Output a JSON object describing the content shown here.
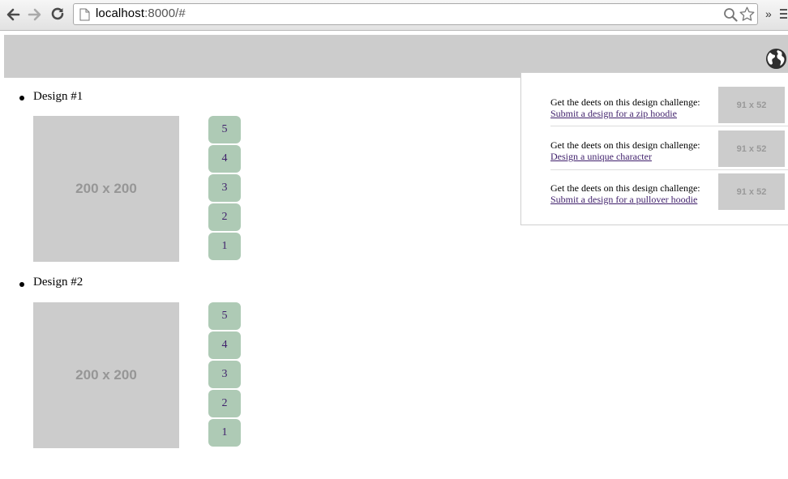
{
  "browser": {
    "url_host": "localhost",
    "url_rest": ":8000/#",
    "extensions_label": "»"
  },
  "designs": [
    {
      "label": "Design #1",
      "image_label": "200 x 200",
      "votes": [
        "5",
        "4",
        "3",
        "2",
        "1"
      ]
    },
    {
      "label": "Design #2",
      "image_label": "200 x 200",
      "votes": [
        "5",
        "4",
        "3",
        "2",
        "1"
      ]
    }
  ],
  "challenges": [
    {
      "text": "Get the deets on this design challenge:",
      "link": "Submit a design for a zip hoodie",
      "thumb": "91 x 52"
    },
    {
      "text": "Get the deets on this design challenge:",
      "link": "Design a unique character",
      "thumb": "91 x 52"
    },
    {
      "text": "Get the deets on this design challenge:",
      "link": "Submit a design for a pullover hoodie",
      "thumb": "91 x 52"
    }
  ],
  "colors": {
    "header_bg": "#cccccc",
    "vote_bg": "#aecab5",
    "link": "#3f1f6b"
  },
  "icons": [
    "back-arrow-icon",
    "forward-arrow-icon",
    "reload-icon",
    "page-icon",
    "zoom-icon",
    "star-icon",
    "menu-icon",
    "globe-icon"
  ]
}
